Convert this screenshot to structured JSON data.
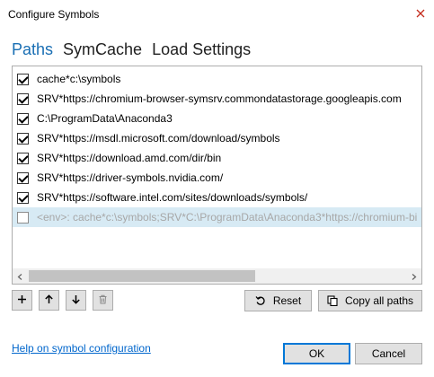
{
  "window": {
    "title": "Configure Symbols"
  },
  "tabs": [
    {
      "label": "Paths",
      "active": true
    },
    {
      "label": "SymCache",
      "active": false
    },
    {
      "label": "Load Settings",
      "active": false
    }
  ],
  "paths": [
    {
      "text": "cache*c:\\symbols",
      "checked": true
    },
    {
      "text": "SRV*https://chromium-browser-symsrv.commondatastorage.googleapis.com",
      "checked": true
    },
    {
      "text": "C:\\ProgramData\\Anaconda3",
      "checked": true
    },
    {
      "text": "SRV*https://msdl.microsoft.com/download/symbols",
      "checked": true
    },
    {
      "text": "SRV*https://download.amd.com/dir/bin",
      "checked": true
    },
    {
      "text": "SRV*https://driver-symbols.nvidia.com/",
      "checked": true
    },
    {
      "text": "SRV*https://software.intel.com/sites/downloads/symbols/",
      "checked": true
    },
    {
      "text": "<env>: cache*c:\\symbols;SRV*C:\\ProgramData\\Anaconda3*https://chromium-bi",
      "checked": false,
      "placeholder": true,
      "selected": true
    }
  ],
  "toolbar": {
    "add_icon": "plus-icon",
    "move_up_icon": "arrow-up-icon",
    "move_down_icon": "arrow-down-icon",
    "delete_icon": "trash-icon"
  },
  "buttons": {
    "reset_label": "Reset",
    "copy_all_label": "Copy all paths",
    "ok_label": "OK",
    "cancel_label": "Cancel"
  },
  "help_link": "Help on symbol configuration",
  "colors": {
    "accent": "#1a6fb4",
    "link": "#0066cc",
    "selection": "#d7eaf4",
    "close_icon": "#c42b1c"
  }
}
